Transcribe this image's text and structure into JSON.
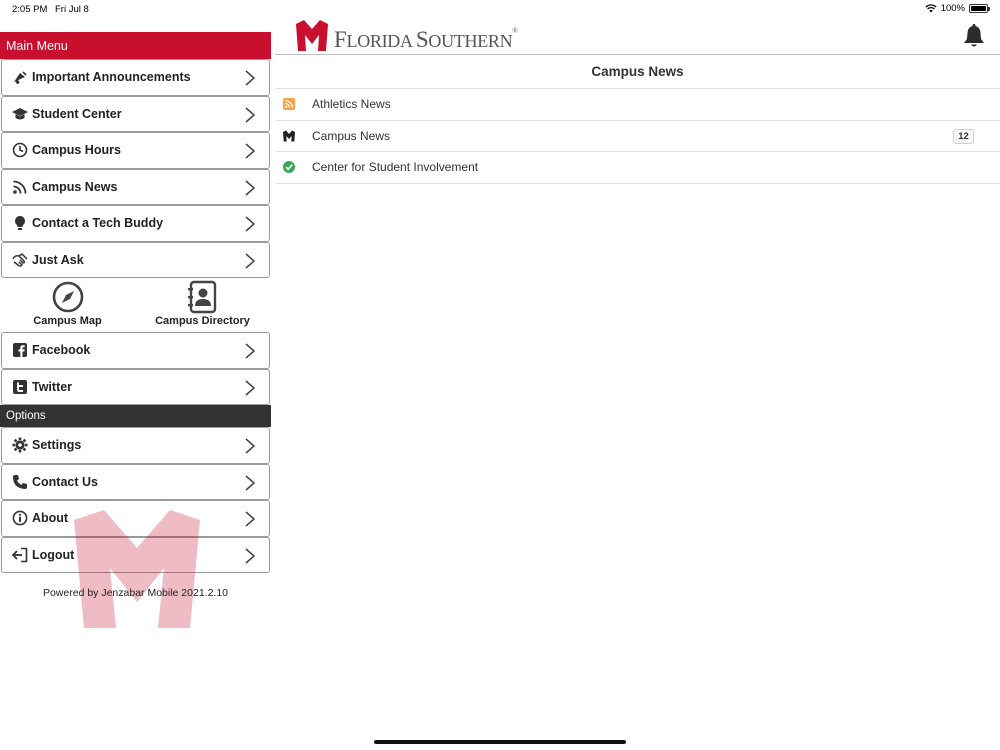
{
  "status_bar": {
    "time": "2:05 PM",
    "date": "Fri Jul 8",
    "battery": "100%",
    "battery_level": 1.0
  },
  "sidebar": {
    "main_menu_title": "Main Menu",
    "main_items": [
      {
        "label": "Important Announcements",
        "icon": "megaphone-icon"
      },
      {
        "label": "Student Center",
        "icon": "graduation-cap-icon"
      },
      {
        "label": "Campus Hours",
        "icon": "clock-icon"
      },
      {
        "label": "Campus News",
        "icon": "rss-icon"
      },
      {
        "label": "Contact a Tech Buddy",
        "icon": "lightbulb-icon"
      },
      {
        "label": "Just Ask",
        "icon": "handshake-icon"
      }
    ],
    "tiles": [
      {
        "label": "Campus Map",
        "icon": "compass-icon"
      },
      {
        "label": "Campus Directory",
        "icon": "address-book-icon"
      }
    ],
    "social_items": [
      {
        "label": "Facebook",
        "icon": "facebook-icon"
      },
      {
        "label": "Twitter",
        "icon": "twitter-icon"
      }
    ],
    "options_title": "Options",
    "option_items": [
      {
        "label": "Settings",
        "icon": "gear-icon"
      },
      {
        "label": "Contact Us",
        "icon": "phone-icon"
      },
      {
        "label": "About",
        "icon": "info-icon"
      },
      {
        "label": "Logout",
        "icon": "logout-icon"
      }
    ],
    "powered_by": "Powered by Jenzabar Mobile 2021.2.10"
  },
  "header": {
    "logo_text_big_1": "F",
    "logo_text_small_1": "LORIDA ",
    "logo_text_big_2": "S",
    "logo_text_small_2": "OUTHERN",
    "logo_reg": "®",
    "brand_color": "#c8102e"
  },
  "main": {
    "title": "Campus News",
    "feeds": [
      {
        "label": "Athletics News",
        "icon": "rss-feed-icon",
        "badge": ""
      },
      {
        "label": "Campus News",
        "icon": "fsc-logo-icon",
        "badge": "12"
      },
      {
        "label": "Center for Student Involvement",
        "icon": "csi-check-icon",
        "badge": ""
      }
    ]
  }
}
